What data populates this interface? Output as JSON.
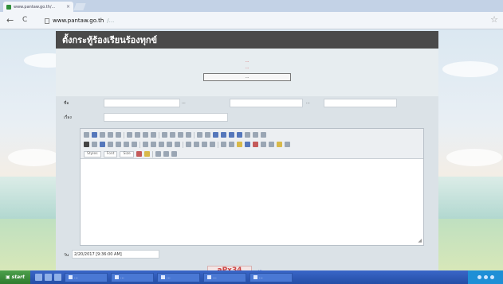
{
  "browser": {
    "tab_title": "www.pantaw.go.th/...",
    "tab_close": "×",
    "back": "←",
    "forward": "C",
    "url_domain": "www.pantaw.go.th",
    "url_path": "/...",
    "bookmark_star": "☆"
  },
  "page": {
    "title": "ตั้งกระทู้ร้องเรียนร้องทุกข์",
    "notice_line1": "...",
    "notice_line2": "...",
    "form_link_button": "..."
  },
  "form": {
    "name_label": "ชื่อ",
    "phone_label": "...",
    "email_label": "...",
    "subject_label": "เรื่อง",
    "date_label": "วัน",
    "date_value": "2/20/2017 [9:36:00 AM]",
    "captcha_text": "aPx34",
    "captcha_refresh": "..."
  },
  "editor": {
    "format_select": "Styles",
    "font_select": "Font",
    "size_select": "Size"
  },
  "taskbar": {
    "start_label": "start",
    "tasks": [
      "...",
      "...",
      "...",
      "...",
      "..."
    ]
  },
  "colors": {
    "header_bg": "#4a4a4a",
    "notice_red": "#d03c3c",
    "taskbar_blue": "#244ea6",
    "start_green": "#2f7b2f"
  }
}
